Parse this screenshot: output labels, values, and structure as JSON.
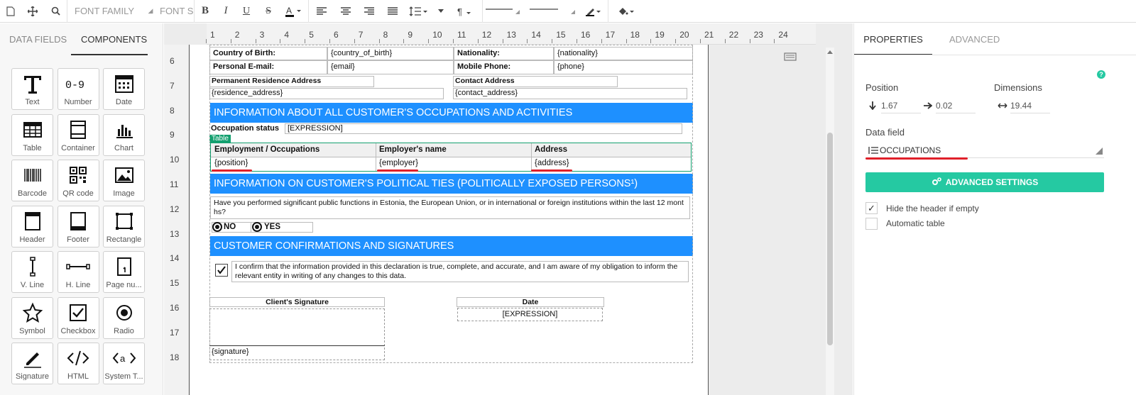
{
  "toolbar": {
    "font_family": "FONT FAMILY",
    "font_size": "FONT SI"
  },
  "left_tabs": [
    "DATA FIELDS",
    "COMPONENTS"
  ],
  "components": [
    "Text",
    "Number",
    "Date",
    "Table",
    "Container",
    "Chart",
    "Barcode",
    "QR code",
    "Image",
    "Header",
    "Footer",
    "Rectangle",
    "V. Line",
    "H. Line",
    "Page nu...",
    "Symbol",
    "Checkbox",
    "Radio",
    "Signature",
    "HTML",
    "System T..."
  ],
  "number_glyph": "0-9",
  "ruler_top": [
    "1",
    "2",
    "3",
    "4",
    "5",
    "6",
    "7",
    "8",
    "9",
    "10",
    "11",
    "12",
    "13",
    "14",
    "15",
    "16",
    "17",
    "18",
    "19",
    "20",
    "21",
    "22",
    "23",
    "24"
  ],
  "ruler_left": [
    "6",
    "7",
    "8",
    "9",
    "10",
    "11",
    "12",
    "13",
    "14",
    "15",
    "16",
    "17",
    "18"
  ],
  "doc": {
    "country_label": "Country of Birth:",
    "country_val": "{country_of_birth}",
    "nationality_label": "Nationality:",
    "nationality_val": "{nationality}",
    "email_label": "Personal E-mail:",
    "email_val": "{email}",
    "phone_label": "Mobile Phone:",
    "phone_val": "{phone}",
    "residence_label": "Permanent Residence Address",
    "residence_val": "{residence_address}",
    "contact_label": "Contact Address",
    "contact_val": "{contact_address}",
    "band1": "INFORMATION ABOUT ALL CUSTOMER'S OCCUPATIONS AND ACTIVITIES",
    "occ_status_label": "Occupation status",
    "occ_status_val": "[EXPRESSION]",
    "table_tag": "Table",
    "col1": "Employment / Occupations",
    "col2": "Employer's name",
    "col3": "Address",
    "val1": "{position}",
    "val2": "{employer}",
    "val3": "{address}",
    "band2": "INFORMATION ON CUSTOMER'S POLITICAL TIES (POLITICALLY EXPOSED PERSONS¹)",
    "question": "Have you performed significant public functions in Estonia, the European Union, or in international or foreign institutions within the last 12 months?",
    "no": "NO",
    "yes": "YES",
    "band3": "CUSTOMER CONFIRMATIONS AND SIGNATURES",
    "confirm": "I confirm that the information provided in this declaration is true, complete, and accurate, and I am aware of my obligation to inform the relevant entity in writing of any changes to this data.",
    "sig_label": "Client's Signature",
    "sig_val": "{signature}",
    "date_label": "Date",
    "date_val": "[EXPRESSION]"
  },
  "right_tabs": [
    "PROPERTIES",
    "ADVANCED"
  ],
  "props": {
    "position_label": "Position",
    "dimensions_label": "Dimensions",
    "pos_top": "1.67",
    "pos_left": "0.02",
    "width": "19.44",
    "datafield_label": "Data field",
    "datafield_val": "OCCUPATIONS",
    "adv_btn": "ADVANCED SETTINGS",
    "hide_header": "Hide the header if empty",
    "auto_table": "Automatic table",
    "hide_header_checked": true,
    "auto_table_checked": false
  },
  "colors": {
    "band": "#1e90ff",
    "accent": "#25c9a2",
    "underline": "#e0202a",
    "table_tag": "#13a06f"
  }
}
